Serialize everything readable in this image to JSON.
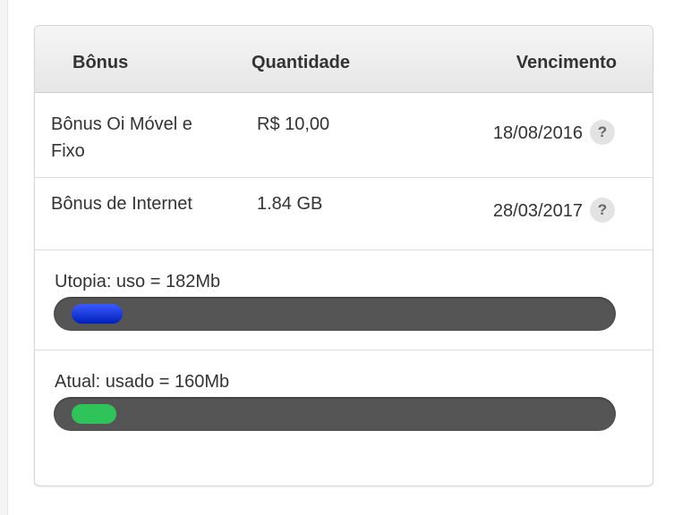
{
  "table": {
    "headers": [
      "Bônus",
      "Quantidade",
      "Vencimento"
    ],
    "rows": [
      {
        "name": "Bônus Oi Móvel e Fixo",
        "quantity": "R$ 10,00",
        "expiry": "18/08/2016",
        "help": "?"
      },
      {
        "name": "Bônus de Internet",
        "quantity": "1.84 GB",
        "expiry": "28/03/2017",
        "help": "?"
      }
    ]
  },
  "usage": [
    {
      "label": "Utopia: uso = 182Mb",
      "fill_fraction": 0.09,
      "color": "#0a2fd6"
    },
    {
      "label": "Atual: usado = 160Mb",
      "fill_fraction": 0.08,
      "color": "#2fc45a"
    }
  ]
}
